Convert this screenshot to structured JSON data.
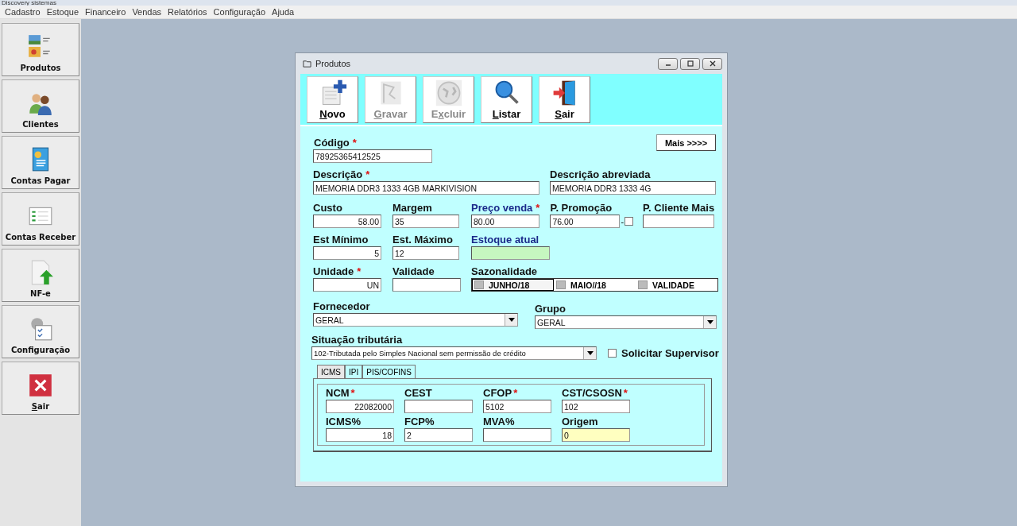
{
  "app_title": "Discovery sistemas",
  "menu": [
    "Cadastro",
    "Estoque",
    "Financeiro",
    "Vendas",
    "Relatórios",
    "Configuração",
    "Ajuda"
  ],
  "sidebar": [
    {
      "label": "Produtos",
      "kind": "products"
    },
    {
      "label": "Clientes",
      "kind": "clients"
    },
    {
      "label": "Contas Pagar",
      "kind": "payables"
    },
    {
      "label": "Contas Receber",
      "kind": "receivables"
    },
    {
      "label": "NF-e",
      "kind": "invoice"
    },
    {
      "label": "Configuração",
      "kind": "settings"
    },
    {
      "key": "S",
      "after": "air",
      "kind": "exit"
    }
  ],
  "window": {
    "title": "Produtos"
  },
  "toolbar": [
    {
      "key": "N",
      "after": "ovo",
      "kind": "new",
      "disabled": false
    },
    {
      "key": "G",
      "after": "ravar",
      "kind": "save",
      "disabled": true
    },
    {
      "before": "E",
      "key": "x",
      "after": "cluir",
      "kind": "delete",
      "disabled": true
    },
    {
      "key": "L",
      "after": "istar",
      "kind": "search",
      "disabled": false
    },
    {
      "key": "S",
      "after": "air",
      "kind": "exit",
      "disabled": false
    }
  ],
  "more_button": "Mais >>>>",
  "rows": [
    [
      {
        "label": "Código",
        "mark": "*",
        "value": "78925365412525"
      }
    ],
    [
      {
        "label": "Descrição",
        "mark": "*",
        "value": "MEMORIA DDR3 1333 4GB MARKIVISION"
      },
      {
        "label": "Descrição abreviada",
        "value": "MEMORIA DDR3 1333 4G"
      }
    ],
    [
      {
        "label": "Custo",
        "value": "58.00"
      },
      {
        "label": "Margem",
        "value": "35"
      },
      {
        "label": "Preço venda",
        "mark": "*",
        "value": "80.00",
        "emphasis": true
      },
      {
        "label": "P. Promoção",
        "value": "76.00",
        "check": {
          "prefix": "-",
          "checked": false
        }
      },
      {
        "label": "P. Cliente Mais"
      }
    ],
    [
      {
        "label": "Est Mínimo",
        "value": "5"
      },
      {
        "label": "Est. Máximo",
        "value": "12"
      },
      {
        "label": "Estoque atual",
        "emphasis": true,
        "color": "#c6f7c0"
      }
    ],
    [
      {
        "label": "Unidade",
        "mark": "*",
        "value": "UN"
      },
      {
        "label": "Validade"
      },
      {
        "label": "Sazonalidade",
        "kind": "toggles",
        "items": [
          {
            "label": "JUNHO/18",
            "selected": true
          },
          {
            "label": "MAIO//18",
            "selected": false
          },
          {
            "label": "VALIDADE",
            "selected": false
          }
        ]
      }
    ],
    [
      {
        "label": "Fornecedor",
        "value": "GERAL",
        "kind": "combo"
      },
      {
        "label": "Grupo",
        "value": "GERAL",
        "kind": "combo"
      }
    ],
    [
      {
        "label": "Situação tributária",
        "value": "102-Tributada pelo Simples Nacional sem permissão de crédito",
        "kind": "combo",
        "check": {
          "label": "Solicitar Supervisor",
          "checked": false
        }
      }
    ]
  ],
  "tabs": [
    {
      "label": "ICMS",
      "selected": true
    },
    {
      "label": "IPI",
      "selected": false
    },
    {
      "label": "PIS/COFINS",
      "selected": false
    }
  ],
  "tab_rows": [
    [
      {
        "label": "NCM",
        "mark": "*",
        "value": "22082000"
      },
      {
        "label": "CEST"
      },
      {
        "label": "CFOP",
        "mark": "*",
        "value": "5102"
      },
      {
        "label": "CST/CSOSN",
        "mark": "*",
        "value": "102"
      }
    ],
    [
      {
        "label": "ICMS%",
        "value": "18"
      },
      {
        "label": "FCP%",
        "value": "2"
      },
      {
        "label": "MVA%"
      },
      {
        "label": "Origem",
        "value": "0",
        "color": "#ffffc0"
      }
    ]
  ]
}
